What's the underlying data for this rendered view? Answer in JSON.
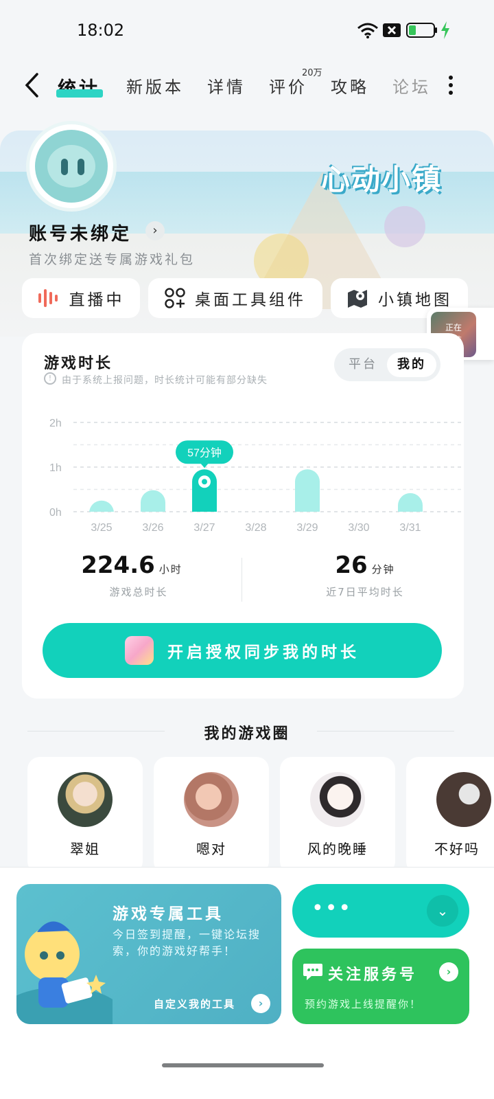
{
  "status_bar": {
    "time": "18:02"
  },
  "nav": {
    "tabs": [
      "统计",
      "新版本",
      "详情",
      "评价",
      "攻略",
      "论坛"
    ],
    "active_tab": "统计",
    "review_badge": "20万"
  },
  "account": {
    "name": "账号未绑定",
    "subtitle": "首次绑定送专属游戏礼包",
    "game_logo_text": "心动小镇"
  },
  "quick_actions": [
    {
      "label": "直播中",
      "icon": "live-icon"
    },
    {
      "label": "桌面工具组件",
      "icon": "widgets-icon"
    },
    {
      "label": "小镇地图",
      "icon": "map-icon"
    }
  ],
  "install_float": {
    "label": "正在\n安装"
  },
  "playtime": {
    "title": "游戏时长",
    "note": "由于系统上报问题，时长统计可能有部分缺失",
    "segments": [
      "平台",
      "我的"
    ],
    "active_segment": "我的",
    "total_value": "224.6",
    "total_unit": "小时",
    "total_label": "游戏总时长",
    "avg_value": "26",
    "avg_unit": "分钟",
    "avg_label": "近7日平均时长",
    "cta": "开启授权同步我的时长"
  },
  "chart_data": {
    "type": "bar",
    "categories": [
      "3/25",
      "3/26",
      "3/27",
      "3/28",
      "3/29",
      "3/30",
      "3/31"
    ],
    "values": [
      15,
      29,
      57,
      0,
      57,
      0,
      25
    ],
    "y_ticks": [
      "0h",
      "1h",
      "2h"
    ],
    "ylim": [
      0,
      120
    ],
    "highlight_index": 2,
    "highlight_label": "57分钟",
    "colors": {
      "bar": "#a8efe9",
      "highlight": "#12d1bb"
    }
  },
  "circle": {
    "title": "我的游戏圈",
    "friends": [
      {
        "name": "翠姐",
        "color": "#8a9a7a"
      },
      {
        "name": "嗯对",
        "color": "#c98c7a"
      },
      {
        "name": "风的晚睡",
        "color": "#e9e4e8"
      },
      {
        "name": "不好吗",
        "color": "#4a3a34"
      }
    ]
  },
  "bottom": {
    "tool_title": "游戏专属工具",
    "tool_desc": "今日签到提醒，一键论坛搜索，你的游戏好帮手！",
    "tool_link": "自定义我的工具",
    "more_label": "•••",
    "follow_title": "关注服务号",
    "follow_desc": "预约游戏上线提醒你！"
  },
  "colors": {
    "accent": "#12d1bb",
    "green": "#2ec35d",
    "tool_bg": "#56b8ca"
  }
}
